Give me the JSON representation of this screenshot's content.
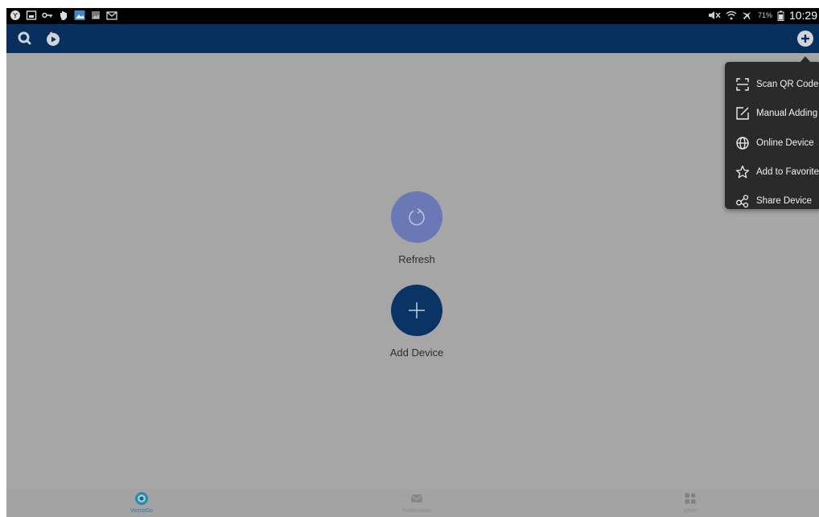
{
  "status_bar": {
    "battery_percent": "71%",
    "time": "10:29"
  },
  "app_bar": {
    "icons": [
      "search-icon",
      "playback-icon",
      "add-circle-icon"
    ]
  },
  "center": {
    "refresh_label": "Refresh",
    "add_device_label": "Add Device"
  },
  "menu": {
    "items": [
      {
        "label": "Scan QR Code",
        "icon": "scan-qr-icon"
      },
      {
        "label": "Manual Adding",
        "icon": "edit-icon"
      },
      {
        "label": "Online Device",
        "icon": "globe-icon"
      },
      {
        "label": "Add to Favorites",
        "icon": "star-icon"
      },
      {
        "label": "Share Device",
        "icon": "share-icon"
      }
    ]
  },
  "tabbar": {
    "tabs": [
      {
        "label": "VezcoGo",
        "icon": "camera-lens-icon",
        "active": true
      },
      {
        "label": "Notification",
        "icon": "envelope-icon",
        "active": false
      },
      {
        "label": "More",
        "icon": "grid-icon",
        "active": false
      }
    ]
  },
  "colors": {
    "app_bar": "#062f5d",
    "overlay_background": "#a6a6a6",
    "refresh_button": "#6a78b5",
    "add_button": "#0b3466",
    "menu_background": "#2a2a2a",
    "active_tab": "#2a7b9c"
  }
}
